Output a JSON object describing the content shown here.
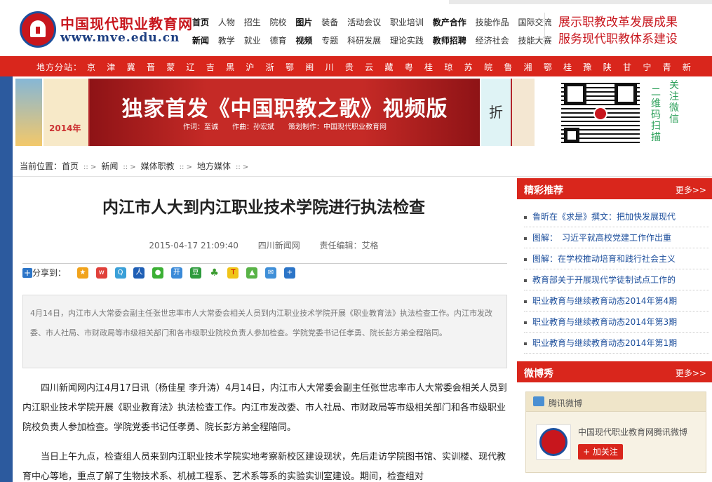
{
  "site": {
    "logo_name": "中国现代职业教育网",
    "logo_url": "www.mve.edu.cn",
    "slogan_line1": "展示职教改革发展成果",
    "slogan_line2": "服务现代职教体系建设"
  },
  "topnav": {
    "row1": [
      "首页",
      "人物",
      "招生",
      "院校",
      "图片",
      "装备",
      "活动会议",
      "职业培训",
      "教产合作",
      "技能作品",
      "国际交流"
    ],
    "row2": [
      "新闻",
      "教学",
      "就业",
      "德育",
      "视频",
      "专题",
      "科研发展",
      "理论实践",
      "教师招聘",
      "经济社会",
      "技能大赛"
    ]
  },
  "branch": {
    "label": "地方分站：",
    "items": [
      "京",
      "津",
      "冀",
      "晋",
      "蒙",
      "辽",
      "吉",
      "黑",
      "沪",
      "浙",
      "鄂",
      "闽",
      "川",
      "贵",
      "云",
      "藏",
      "粤",
      "桂",
      "琼",
      "苏",
      "皖",
      "鲁",
      "湘",
      "鄂",
      "桂",
      "豫",
      "陕",
      "甘",
      "宁",
      "青",
      "新"
    ]
  },
  "banner": {
    "title": "独家首发《中国职教之歌》视频版",
    "credits": "作词：至诚　　作曲：孙宏斌　　策划制作：中国现代职业教育网",
    "thumb2_year": "2014年",
    "thumb3_text": "折"
  },
  "follow": {
    "col1": "二维码扫描",
    "col2": "关注微信"
  },
  "breadcrumb": {
    "label": "当前位置：",
    "items": [
      "首页",
      "新闻",
      "媒体职教",
      "地方媒体"
    ]
  },
  "article": {
    "title": "内江市人大到内江职业技术学院进行执法检查",
    "date": "2015-04-17 21:09:40",
    "source": "四川新闻网",
    "editor": "责任编辑：艾格",
    "share_label": "分享到：",
    "summary": "4月14日，内江市人大常委会副主任张世忠率市人大常委会相关人员到内江职业技术学院开展《职业教育法》执法检查工作。内江市发改委、市人社局、市财政局等市级相关部门和各市级职业院校负责人参加检查。学院党委书记任孝勇、院长彭方弟全程陪同。",
    "para1": "四川新闻网内江4月17日讯（杨佳星 李升涛）4月14日，内江市人大常委会副主任张世忠率市人大常委会相关人员到内江职业技术学院开展《职业教育法》执法检查工作。内江市发改委、市人社局、市财政局等市级相关部门和各市级职业院校负责人参加检查。学院党委书记任孝勇、院长彭方弟全程陪同。",
    "para2": "当日上午九点，检查组人员来到内江职业技术学院实地考察新校区建设现状，先后走访学院图书馆、实训楼、现代教育中心等地，重点了解了生物技术系、机械工程系、艺术系等系的实验实训室建设。期间，检查组对"
  },
  "sidebar": {
    "rec_title": "精彩推荐",
    "more": "更多>>",
    "rec_items": [
      "鲁昕在《求是》撰文：把加快发展现代",
      "图解：　习近平就高校党建工作作出重",
      "图解：在学校推动培育和践行社会主义",
      "教育部关于开展现代学徒制试点工作的",
      "职业教育与继续教育动态2014年第4期",
      "职业教育与继续教育动态2014年第3期",
      "职业教育与继续教育动态2014年第1期"
    ],
    "weibo_title": "微博秀",
    "weibo_box_title": "腾讯微博",
    "weibo_name": "中国现代职业教育网腾讯微博",
    "follow_btn": "+ 加关注"
  },
  "colors": {
    "brand_red": "#d9261c",
    "logo_blue": "#1d3f82",
    "link_blue": "#1d4f9c",
    "qr_follow_green": "#2ca05a"
  }
}
